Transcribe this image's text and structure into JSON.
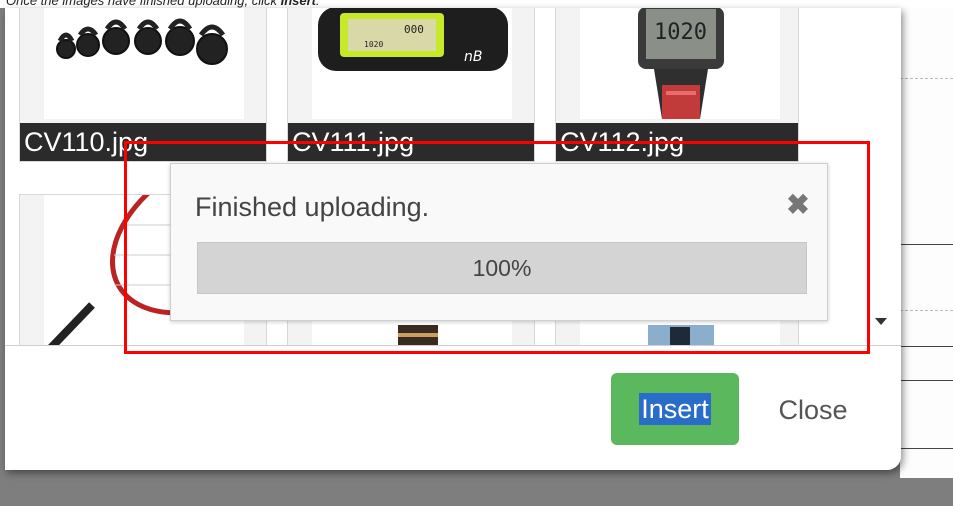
{
  "instruction": {
    "prefix": "Once the images have finished uploading, click ",
    "action": "Insert",
    "suffix": "."
  },
  "gallery": {
    "thumbnails": [
      {
        "caption": "CV110.jpg",
        "icon": "kettlebells-image"
      },
      {
        "caption": "CV111.jpg",
        "icon": "pedometer-image"
      },
      {
        "caption": "CV112.jpg",
        "icon": "heart-rate-monitor-image"
      }
    ],
    "second_row": [
      {
        "icon": "tennis-racket-image"
      },
      {
        "icon": "sports-tape-image"
      },
      {
        "icon": "water-bottle-image"
      }
    ]
  },
  "upload_toast": {
    "message": "Finished uploading.",
    "progress_label": "100%",
    "progress_value": 100
  },
  "footer": {
    "insert_label": "Insert",
    "close_label": "Close"
  },
  "colors": {
    "insert_button": "#5cb85c",
    "text_selection": "#2a6cc9",
    "highlight_box": "#ff0000",
    "caption_bar": "#2b2b2b"
  }
}
